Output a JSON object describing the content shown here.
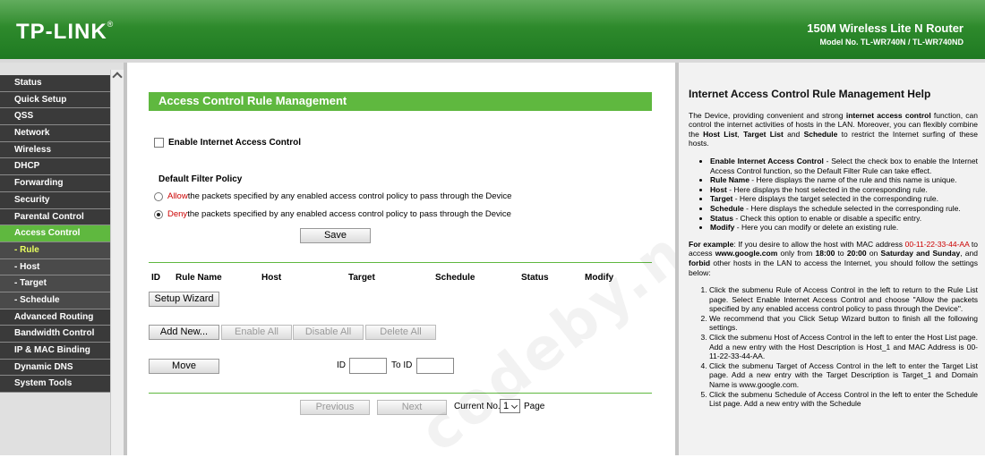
{
  "header": {
    "logo": "TP-LINK",
    "logo_mark": "®",
    "product_name": "150M Wireless Lite N Router",
    "model_no": "Model No. TL-WR740N / TL-WR740ND"
  },
  "sidebar": {
    "items": [
      {
        "label": "Status"
      },
      {
        "label": "Quick Setup"
      },
      {
        "label": "QSS"
      },
      {
        "label": "Network"
      },
      {
        "label": "Wireless"
      },
      {
        "label": "DHCP"
      },
      {
        "label": "Forwarding"
      },
      {
        "label": "Security"
      },
      {
        "label": "Parental Control"
      },
      {
        "label": "Access Control"
      },
      {
        "label": "- Rule"
      },
      {
        "label": "- Host"
      },
      {
        "label": "- Target"
      },
      {
        "label": "- Schedule"
      },
      {
        "label": "Advanced Routing"
      },
      {
        "label": "Bandwidth Control"
      },
      {
        "label": "IP & MAC Binding"
      },
      {
        "label": "Dynamic DNS"
      },
      {
        "label": "System Tools"
      }
    ]
  },
  "main": {
    "title": "Access Control Rule Management",
    "enable_label": "Enable Internet Access Control",
    "policy_title": "Default Filter Policy",
    "allow_word": "Allow",
    "allow_rest": " the packets specified by any enabled access control policy to pass through the Device",
    "deny_word": "Deny",
    "deny_rest": " the packets specified by any enabled access control policy to pass through the Device",
    "save_label": "Save",
    "columns": [
      "ID",
      "Rule Name",
      "Host",
      "Target",
      "Schedule",
      "Status",
      "Modify"
    ],
    "setup_wizard_label": "Setup Wizard",
    "add_new_label": "Add New...",
    "enable_all_label": "Enable All",
    "disable_all_label": "Disable All",
    "delete_all_label": "Delete All",
    "move_label": "Move",
    "id_label": "ID",
    "to_id_label": "To ID",
    "previous_label": "Previous",
    "next_label": "Next",
    "current_no_label": "Current No.",
    "current_no_value": "1",
    "page_label": "Page",
    "watermark": "codeby.net"
  },
  "help": {
    "title": "Internet Access Control Rule Management Help",
    "intro_1": "The Device, providing convenient and strong ",
    "intro_b1": "internet access control",
    "intro_2": " function, can control the internet activities of hosts in the LAN. Moreover, you can flexibly combine the ",
    "intro_b2": "Host List",
    "intro_3": ", ",
    "intro_b3": "Target List",
    "intro_4": " and ",
    "intro_b4": "Schedule",
    "intro_5": " to restrict the Internet surfing of these hosts.",
    "bullets": [
      {
        "term": "Enable Internet Access Control",
        "text": " - Select the check box to enable the Internet Access Control function, so the Default Filter Rule can take effect."
      },
      {
        "term": "Rule Name",
        "text": " - Here displays the name of the rule and this name is unique."
      },
      {
        "term": "Host",
        "text": " - Here displays the host selected in the corresponding rule."
      },
      {
        "term": "Target",
        "text": " - Here displays the target selected in the corresponding rule."
      },
      {
        "term": "Schedule",
        "text": " - Here displays the schedule selected in the corresponding rule."
      },
      {
        "term": "Status",
        "text": " - Check this option to enable or disable a specific entry."
      },
      {
        "term": "Modify",
        "text": " - Here you can modify or delete an existing rule."
      }
    ],
    "example_b": "For example",
    "example_1": ": If you desire to allow the host with MAC address ",
    "example_mac": "00-11-22-33-44-AA",
    "example_2": " to access ",
    "example_site": "www.google.com",
    "example_3": " only from ",
    "example_t1": "18:00",
    "example_4": " to ",
    "example_t2": "20:00",
    "example_5": " on ",
    "example_days": "Saturday and Sunday",
    "example_6": ", and ",
    "example_forbid": "forbid",
    "example_7": " other hosts in the LAN to access the Internet, you should follow the settings below:",
    "steps": [
      "Click the submenu Rule of Access Control in the left to return to the Rule List page. Select Enable Internet Access Control and choose \"Allow the packets specified by any enabled access control policy to pass through the Device\".",
      "We recommend that you Click Setup Wizard button to finish all the following settings.",
      "Click the submenu Host of Access Control in the left to enter the Host List page. Add a new entry with the Host Description is Host_1 and MAC Address is 00-11-22-33-44-AA.",
      "Click the submenu Target of Access Control in the left to enter the Target List page. Add a new entry with the Target Description is Target_1 and Domain Name is www.google.com.",
      "Click the submenu Schedule of Access Control in the left to enter the Schedule List page. Add a new entry with the Schedule"
    ]
  },
  "colors": {
    "brand_green": "#5fb83f",
    "header_green": "#2e8a2c",
    "menu_dark": "#3a3a3a",
    "allow_deny_red": "#cc0000",
    "active_sub": "#e8ff60"
  }
}
